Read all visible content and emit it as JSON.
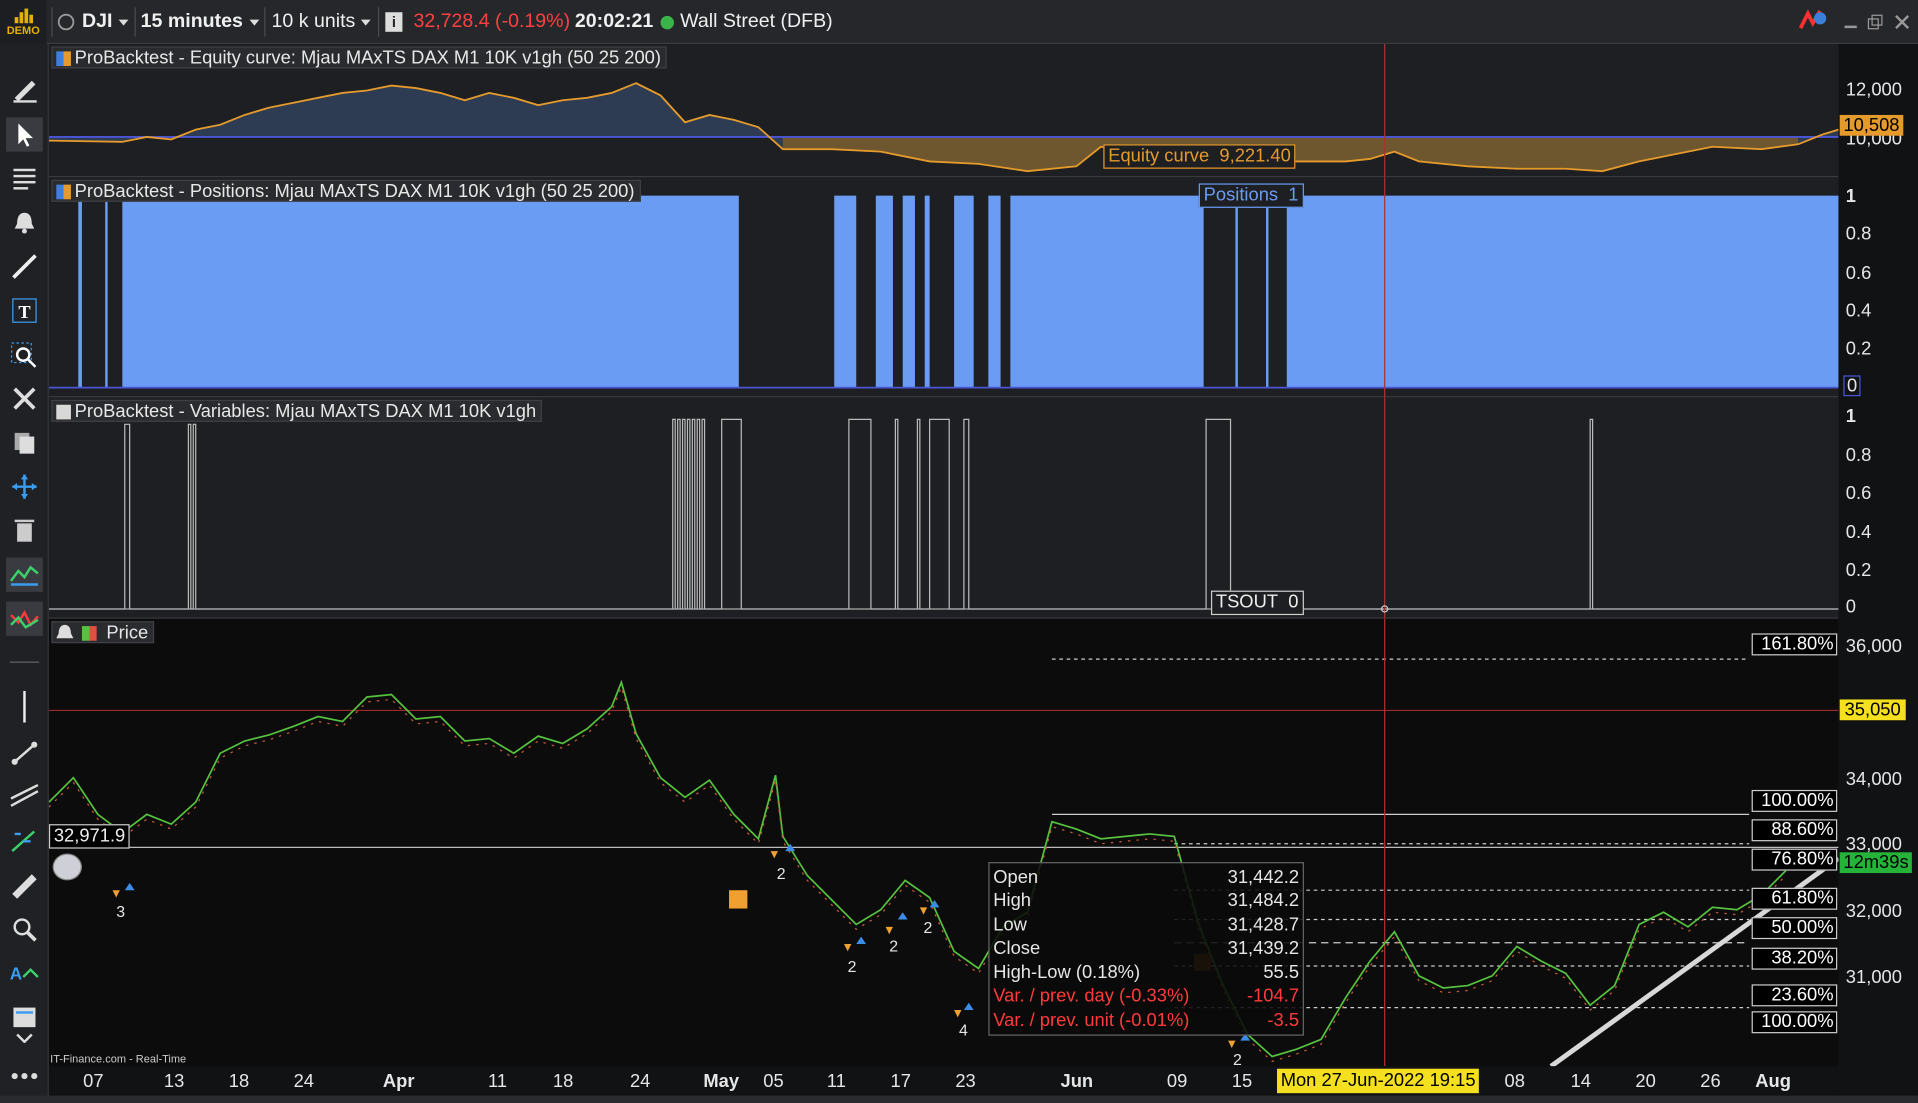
{
  "toolbar": {
    "demo": "DEMO",
    "symbol": "DJI",
    "timeframe": "15 minutes",
    "units": "10 k units",
    "info_icon": "i",
    "price_change": "32,728.4 (-0.19%)",
    "time": "20:02:21",
    "market": "Wall Street (DFB)"
  },
  "panels": {
    "equity": {
      "label": "ProBacktest - Equity curve: Mjau MAxTS DAX M1 10K v1gh (50 25 200)",
      "tooltip_name": "Equity curve",
      "tooltip_value": "9,221.40",
      "axis": [
        "12,000",
        "10,000"
      ],
      "current": "10,508"
    },
    "positions": {
      "label": "ProBacktest - Positions: Mjau MAxTS DAX M1 10K v1gh (50 25 200)",
      "tooltip_name": "Positions",
      "tooltip_value": "1",
      "axis": [
        "1",
        "0.8",
        "0.6",
        "0.4",
        "0.2",
        "0"
      ]
    },
    "variables": {
      "label": "ProBacktest - Variables: Mjau MAxTS DAX M1 10K v1gh",
      "tooltip_name": "TSOUT",
      "tooltip_value": "0",
      "axis": [
        "1",
        "0.8",
        "0.6",
        "0.4",
        "0.2",
        "0"
      ]
    },
    "price": {
      "label": "Price",
      "axis": [
        "36,000",
        "34,000",
        "33,000",
        "32,000",
        "31,000"
      ],
      "alert_level": "35,050",
      "timer": "12m39s",
      "crosshair_price": "32,971.9",
      "source": "IT-Finance.com - Real-Time"
    }
  },
  "fib_levels": [
    "161.80%",
    "100.00%",
    "88.60%",
    "76.80%",
    "61.80%",
    "50.00%",
    "38.20%",
    "23.60%",
    "100.00%"
  ],
  "ohlc": [
    {
      "k": "Open",
      "v": "31,442.2",
      "red": false
    },
    {
      "k": "High",
      "v": "31,484.2",
      "red": false
    },
    {
      "k": "Low",
      "v": "31,428.7",
      "red": false
    },
    {
      "k": "Close",
      "v": "31,439.2",
      "red": false
    },
    {
      "k": "High-Low (0.18%)",
      "v": "55.5",
      "red": false
    },
    {
      "k": "Var. / prev. day (-0.33%)",
      "v": "-104.7",
      "red": true
    },
    {
      "k": "Var. / prev. unit (-0.01%)",
      "v": "-3.5",
      "red": true
    }
  ],
  "trade_counts": [
    "3",
    "2",
    "2",
    "2",
    "2",
    "4",
    "2"
  ],
  "dates": [
    "07",
    "13",
    "18",
    "24",
    "Apr",
    "11",
    "18",
    "24",
    "May",
    "05",
    "11",
    "17",
    "23",
    "Jun",
    "09",
    "15",
    "08",
    "14",
    "20",
    "26",
    "Aug"
  ],
  "crosshair_date": "Mon 27-Jun-2022 19:15"
}
